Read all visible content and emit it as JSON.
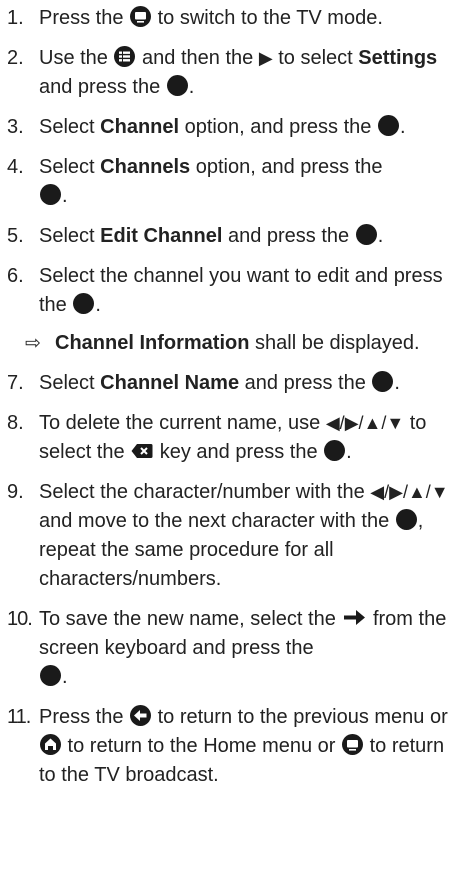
{
  "steps": [
    {
      "num": "1.",
      "t1": "Press the ",
      "t2": " to switch to the TV mode."
    },
    {
      "num": "2.",
      "t1": "Use the ",
      "t2": " and then the ",
      "t3": " to select ",
      "b1": "Settings",
      "t4": " and press the ",
      "t5": "."
    },
    {
      "num": "3.",
      "t1": "Select ",
      "b1": "Channel",
      "t2": " option, and press the ",
      "t3": "."
    },
    {
      "num": "4.",
      "t1": "Select ",
      "b1": "Channels",
      "t2": " option, and press the ",
      "t3": "."
    },
    {
      "num": "5.",
      "t1": "Select ",
      "b1": "Edit Channel",
      "t2": " and press the ",
      "t3": "."
    },
    {
      "num": "6.",
      "t1": "Select the channel you want to edit and press the ",
      "t2": "."
    },
    {
      "num": "7.",
      "t1": "Select ",
      "b1": "Channel Name",
      "t2": " and press the ",
      "t3": "."
    },
    {
      "num": "8.",
      "t1": "To delete the current name, use ",
      "arrows": "◀/▶/▲/▼",
      "t2": " to select the ",
      "t3": " key and press the ",
      "t4": "."
    },
    {
      "num": "9.",
      "t1": "Select the character/number with the ",
      "arrows": "◀/▶/▲/▼",
      "t2": " and move to the next character with the ",
      "t3": ", repeat the same procedure for all characters/numbers."
    },
    {
      "num": "10.",
      "t1": "To save the new name, select the ",
      "t2": " from the screen keyboard and press the ",
      "t3": "."
    },
    {
      "num": "11.",
      "t1": "Press the ",
      "t2": " to return to the previous menu or ",
      "t3": " to return to the Home menu or ",
      "t4": " to return to the TV broadcast."
    }
  ],
  "result": {
    "arrow": "⇨",
    "b1": "Channel Information",
    "t1": " shall be displayed."
  },
  "icons": {
    "tv": "tv-icon",
    "menu": "menu-grid-icon",
    "play": "right-arrow-icon",
    "ok": "ok-button-icon",
    "backspace": "backspace-key-icon",
    "enter": "enter-arrow-icon",
    "back": "back-arrow-icon",
    "home": "home-icon"
  }
}
